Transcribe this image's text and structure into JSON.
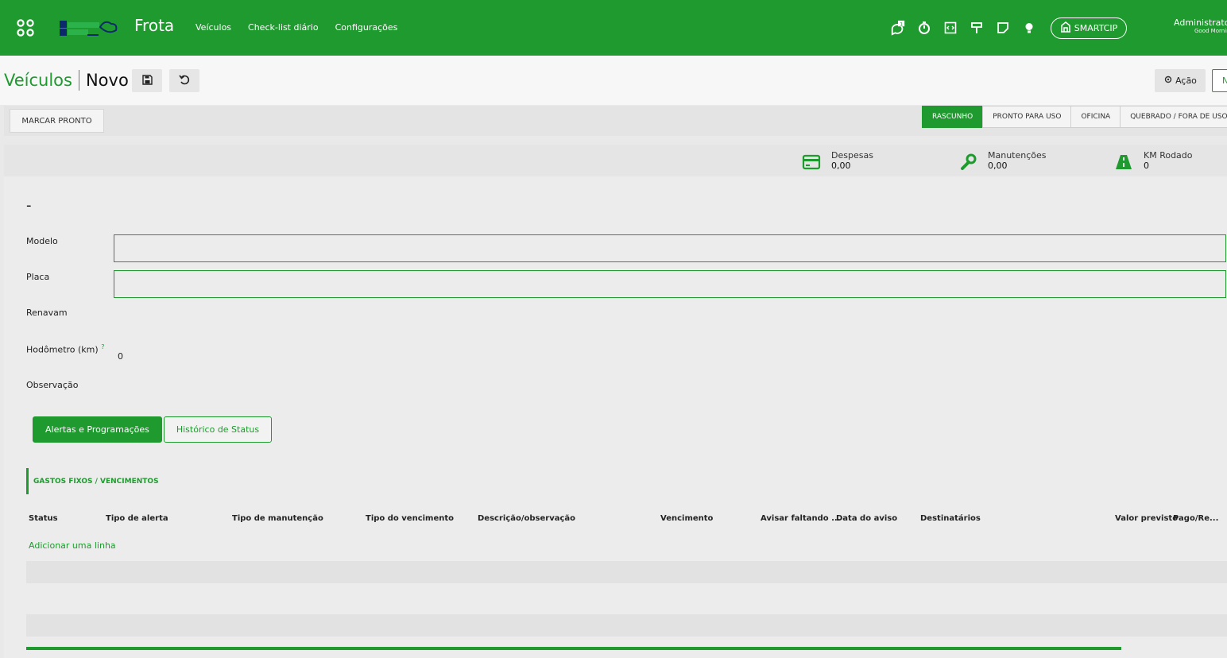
{
  "topbar": {
    "app_title": "Frota",
    "menu": [
      "Veículos",
      "Check-list diário",
      "Configurações"
    ],
    "chat_badge": "1",
    "smartcip_label": "SMARTCIP",
    "user_name": "Administrator",
    "user_greeting": "Good Morning",
    "accent": "#1f9a2f"
  },
  "control": {
    "breadcrumb_parent": "Veículos",
    "breadcrumb_current": "Novo",
    "acao_label": "Ação",
    "new_label": "N"
  },
  "statusbar": {
    "mark_ready": "MARCAR PRONTO",
    "stages": [
      "RASCUNHO",
      "PRONTO PARA USO",
      "OFICINA",
      "QUEBRADO / FORA DE USO"
    ],
    "active_stage": "RASCUNHO"
  },
  "stats": [
    {
      "label": "Despesas",
      "value": "0,00",
      "icon": "credit-card-icon"
    },
    {
      "label": "Manutenções",
      "value": "0,00",
      "icon": "wrench-icon"
    },
    {
      "label": "KM Rodado",
      "value": "0",
      "icon": "road-icon"
    }
  ],
  "form": {
    "title": "-",
    "modelo_label": "Modelo",
    "placa_label": "Placa",
    "renavam_label": "Renavam",
    "hodometro_label": "Hodômetro (km)",
    "hodometro_help": "?",
    "hodometro_value": "0",
    "observacao_label": "Observação"
  },
  "tabs": [
    "Alertas e Programações",
    "Histórico de Status"
  ],
  "section": {
    "title": "GASTOS FIXOS / VENCIMENTOS",
    "columns": [
      "Status",
      "Tipo de alerta",
      "Tipo de manutenção",
      "Tipo do vencimento",
      "Descrição/observação",
      "Vencimento",
      "Avisar faltando ...",
      "Data do aviso",
      "Destinatários",
      "Valor previsto",
      "Pago/Re..."
    ],
    "add_line": "Adicionar uma linha"
  }
}
